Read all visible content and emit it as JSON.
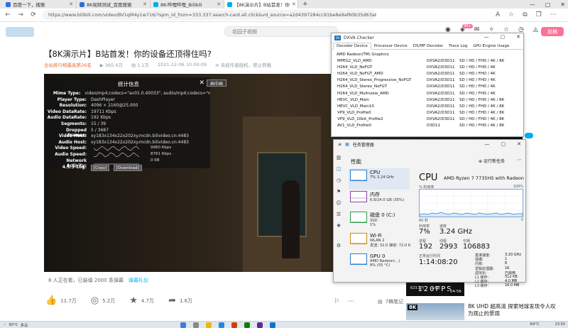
{
  "browser": {
    "tabs": [
      {
        "label": "百度一下，搜索",
        "active": false,
        "color": "#2f6fde"
      },
      {
        "label": "8K视频测试_百度搜索",
        "active": false,
        "color": "#2f6fde"
      },
      {
        "label": "8K-哔哩哔哩_Bilibili",
        "active": false,
        "color": "#00aeec"
      },
      {
        "label": "【8K演示片】B站首发！你",
        "active": true,
        "color": "#00aeec"
      }
    ],
    "url": "https://www.bilibili.com/video/BV1qM4y1w716/?spm_id_from=333.337.search-card.all.click&vd_source=a2d4397284cc91be8e9af60b35d63a80"
  },
  "site": {
    "search_placeholder": "花园子视频",
    "message_badge": "99+",
    "upload_label": "投稿"
  },
  "video": {
    "title": "【8K演示片】B站首发！你的设备还顶得住吗?",
    "rank": "全站排行榜最高第26名",
    "views": "365.4万",
    "danmaku": "1.1万",
    "date": "2021-12-06 10:00:09",
    "no_repost": "未经作者授权，禁止转载",
    "watching": "8 人正在看，已装填 2000 条弹幕",
    "danmu_link": "弹幕礼仪",
    "likes": "11.7万",
    "coins": "5.2万",
    "favs": "4.7万",
    "shares": "1.6万",
    "note_label": "7稿笔记"
  },
  "stats_overlay": {
    "title": "统计信息",
    "tooltip": "画中画",
    "rows": [
      {
        "k": "Mime Type:",
        "v": "video/mp4;codecs=\"av01.0.40033\", audio/mp4;codecs=\"mp4a.40.2\""
      },
      {
        "k": "Player Type:",
        "v": "DashPlayer"
      },
      {
        "k": "Resolution:",
        "v": "4096 × 2160@25.000"
      },
      {
        "k": "Video DataRate:",
        "v": "19711 Kbps"
      },
      {
        "k": "Audio DataRate:",
        "v": "192 Kbps"
      },
      {
        "k": "Segments:",
        "v": "15 / 39"
      },
      {
        "k": "Dropped Frames:",
        "v": "5 / 3687"
      },
      {
        "k": "Video Host:",
        "v": "xy183x134x22x202xy.mcdn.bilivideo.cn:4483"
      },
      {
        "k": "Audio Host:",
        "v": "xy183x134x22x202xy.mcdn.bilivideo.cn:4483"
      }
    ],
    "graph_rows": [
      {
        "k": "Video Speed:",
        "v": "9960 Kbps"
      },
      {
        "k": "Audio Speed:",
        "v": "8761 Kbps"
      },
      {
        "k": "Network Activity:",
        "v": "0 KB"
      }
    ],
    "version": "4.5.3-Log:",
    "copy_btn": "[Copy]",
    "download_btn": "[Download]"
  },
  "dxva": {
    "title": "DXVA Checker",
    "tabs": [
      "Decoder Device",
      "Processor Device",
      "DS/MF Decoder",
      "Trace Log",
      "GPU Engine Usage"
    ],
    "gpu": "AMD Radeon(TM) Graphics",
    "rows": [
      {
        "name": "MPEG2_VLD_AMD",
        "dx": "DXVA2/D3D11",
        "sup": "SD / HD / FHD / 4K / 8K"
      },
      {
        "name": "H264_VLD_NoFGT",
        "dx": "DXVA2/D3D11",
        "sup": "SD / HD / FHD / 4K"
      },
      {
        "name": "H264_VLD_NoFGT_AMD",
        "dx": "DXVA2/D3D11",
        "sup": "SD / HD / FHD / 4K"
      },
      {
        "name": "H264_VLD_Stereo_Progressive_NoFGT",
        "dx": "DXVA2/D3D11",
        "sup": "SD / HD / FHD / 4K"
      },
      {
        "name": "H264_VLD_Stereo_NoFGT",
        "dx": "DXVA2/D3D11",
        "sup": "SD / HD / FHD / 4K"
      },
      {
        "name": "H264_VLD_Multiview_AMD",
        "dx": "DXVA2/D3D11",
        "sup": "SD / HD / FHD / 4K"
      },
      {
        "name": "HEVC_VLD_Main",
        "dx": "DXVA2/D3D11",
        "sup": "SD / HD / FHD / 4K / 8K"
      },
      {
        "name": "HEVC_VLD_Main10",
        "dx": "DXVA2/D3D11",
        "sup": "SD / HD / FHD / 4K / 8K"
      },
      {
        "name": "VP9_VLD_Profile0",
        "dx": "DXVA2/D3D11",
        "sup": "SD / HD / FHD / 4K / 8K"
      },
      {
        "name": "VP9_VLD_10bit_Profile2",
        "dx": "DXVA2/D3D11",
        "sup": "SD / HD / FHD / 4K / 8K"
      },
      {
        "name": "AV1_VLD_Profile0",
        "dx": "D3D11",
        "sup": "SD / HD / FHD / 4K / 8K"
      }
    ]
  },
  "taskmgr": {
    "title": "任务管理器",
    "section": "性能",
    "run_task": "运行新任务",
    "resources": [
      {
        "name": "CPU",
        "sub": "7%  3.24 GHz"
      },
      {
        "name": "内存",
        "sub": "6.8/24.0 GB (35%)"
      },
      {
        "name": "磁盘 0 (C:)",
        "sub": "SSD\n1%"
      },
      {
        "name": "Wi-Fi",
        "sub": "WLAN 2\n发送: 32.0  接收: 72.0 K"
      },
      {
        "name": "GPU 0",
        "sub": "AMD Radeon(...)\n8% (55 °C)"
      }
    ],
    "cpu_title": "CPU",
    "cpu_model": "AMD Ryzen 7 7735HS with Radeon",
    "util_label": "% 利用率",
    "util_max": "100%",
    "axis_left": "60 秒",
    "axis_right": "0",
    "util_stat_label": "利用率",
    "util_stat": "7%",
    "speed_stat_label": "速度",
    "speed_stat": "3.24 GHz",
    "proc_label": "进程",
    "proc": "192",
    "thread_label": "线程",
    "thread": "2993",
    "handle_label": "句柄",
    "handle": "106883",
    "uptime_label": "正常运行时间",
    "uptime": "1:14:08:20",
    "specs": [
      {
        "k": "基准速度:",
        "v": "3.20 GHz"
      },
      {
        "k": "插槽:",
        "v": "1"
      },
      {
        "k": "内核:",
        "v": "8"
      },
      {
        "k": "逻辑处理器:",
        "v": "16"
      },
      {
        "k": "虚拟化:",
        "v": "已启用"
      },
      {
        "k": "L1 缓存:",
        "v": "512 KB"
      },
      {
        "k": "L2 缓存:",
        "v": "4.0 MB"
      },
      {
        "k": "L3 缓存:",
        "v": "16.0 MB"
      }
    ]
  },
  "recommend": {
    "thumb_text": "120FPS",
    "thumb_views": "623.2万",
    "thumb_danmu": "2.6万",
    "thumb_dur": "04:56",
    "badge": "8K",
    "title": "8K UHD 超高清 探索地球发现令人叹为观止的景观"
  },
  "taskbar": {
    "weather": "30°C",
    "weather_desc": "多云",
    "time": "23:50",
    "date": "2023/7/16",
    "cpu_temp": "64°C"
  }
}
